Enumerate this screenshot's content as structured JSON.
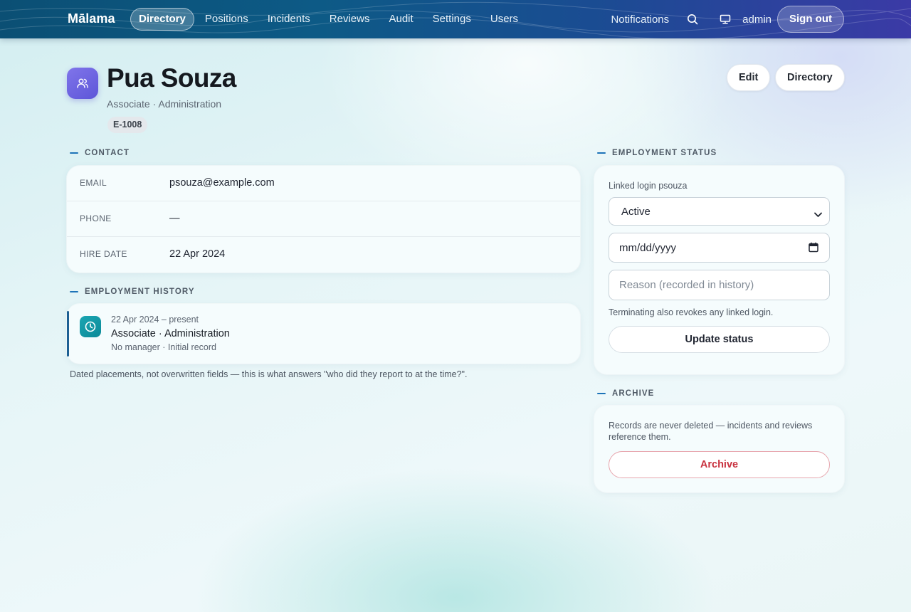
{
  "nav": {
    "brand": "Mālama",
    "links": [
      {
        "label": "Directory",
        "active": true
      },
      {
        "label": "Positions"
      },
      {
        "label": "Incidents"
      },
      {
        "label": "Reviews"
      },
      {
        "label": "Audit"
      },
      {
        "label": "Settings"
      },
      {
        "label": "Users"
      }
    ],
    "notifications_label": "Notifications",
    "search_icon": "search-icon",
    "display_icon": "monitor-icon",
    "username": "admin",
    "signout_label": "Sign out"
  },
  "header": {
    "avatar_icon": "users-icon",
    "name": "Pua Souza",
    "subtitle": "Associate · Administration",
    "badge": "E-1008",
    "edit_label": "Edit",
    "directory_label": "Directory"
  },
  "contact": {
    "section_label": "CONTACT",
    "rows": [
      {
        "key": "EMAIL",
        "value": "psouza@example.com"
      },
      {
        "key": "PHONE",
        "value": "—"
      },
      {
        "key": "HIRE DATE",
        "value": "22 Apr 2024"
      }
    ]
  },
  "history": {
    "section_label": "EMPLOYMENT HISTORY",
    "entries": [
      {
        "icon": "clock-icon",
        "dates": "22 Apr 2024 – present",
        "role": "Associate · Administration",
        "meta": "No manager · Initial record"
      }
    ],
    "note": "Dated placements, not overwritten fields — this is what answers \"who did they report to at the time?\"."
  },
  "status": {
    "section_label": "EMPLOYMENT STATUS",
    "linked_login": "Linked login psouza",
    "selected_status": "Active",
    "date_placeholder": "mm/dd/yyyy",
    "reason_placeholder": "Reason (recorded in history)",
    "note": "Terminating also revokes any linked login.",
    "update_label": "Update status"
  },
  "archive": {
    "section_label": "ARCHIVE",
    "note": "Records are never deleted — incidents and reviews reference them.",
    "button_label": "Archive",
    "danger_color": "#c8323f"
  },
  "colors": {
    "accent": "#1d73b8",
    "nav_start": "#0b4f74",
    "nav_end": "#3b3aa6",
    "avatar": "#6b62e0",
    "history_icon": "#1298a6"
  }
}
